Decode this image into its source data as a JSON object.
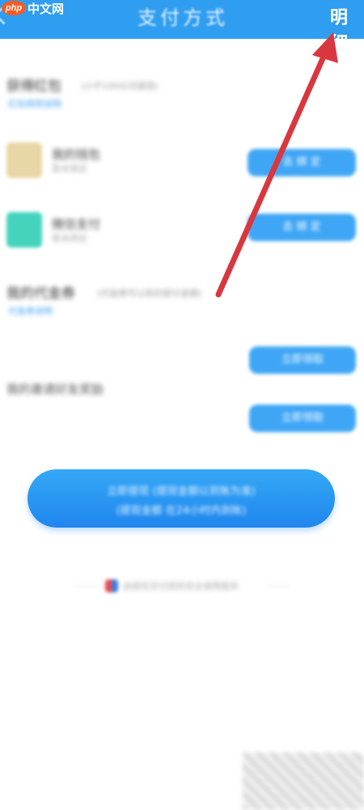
{
  "header": {
    "title": "支付方式",
    "right_label": "明细"
  },
  "watermark": {
    "badge": "php",
    "text": "中文网"
  },
  "section1": {
    "title": "获得红包",
    "subtitle": "(小于100元可提现)",
    "link": "红包规则说明"
  },
  "apps": [
    {
      "name": "我的钱包",
      "sub": "暂未绑定",
      "icon_color": "#e9d6a6",
      "button": "去 绑 定"
    },
    {
      "name": "微信支付",
      "sub": "暂未绑定",
      "icon_color": "#46d3be",
      "button": "去 绑 定"
    }
  ],
  "section2": {
    "title": "我的代金券",
    "subtitle": "(代金券可以抵扣部分金额)",
    "link": "代金券说明"
  },
  "pill3": {
    "label": "立即领取"
  },
  "row4": {
    "label": "我的邀请好友奖励",
    "button": "立即领取"
  },
  "main_button": {
    "line1": "立即提现 (提现金额以到账为准)",
    "line2": "(提现金额 在24小时内到账)"
  },
  "footer": {
    "text": "由微信支付提供安全保障服务"
  },
  "arrow": {
    "color": "#d9373f"
  }
}
